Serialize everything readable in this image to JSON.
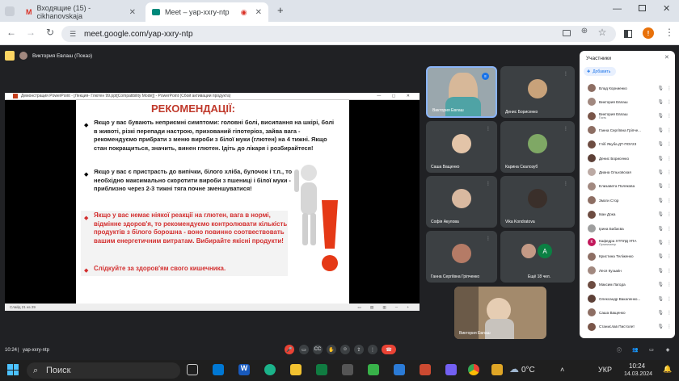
{
  "browser": {
    "tabs": [
      {
        "title": "Входящие (15) - cikhanovskaja",
        "icon": "gmail-icon"
      },
      {
        "title": "Meet – yap-xxry-ntp",
        "icon": "meet-icon"
      }
    ],
    "new_tab": "+",
    "url": "meet.google.com/yap-xxry-ntp",
    "profile_initial": "!"
  },
  "meet": {
    "presenter_label": "Виктория Евлаш (Показ)",
    "meeting_code": "yap-xxry-ntp",
    "time": "10:24",
    "presentation": {
      "window_title": "Демонстрация PowerPoint - [Лекция- Глютен 99.ppt[Compatibility Mode]] - PowerPoint (Сбой активации продукта)",
      "status": "Слайд 21 из 29",
      "slide_title": "РЕКОМЕНДАЦІЇ:",
      "paragraph_1": "Якщо у вас бувають неприємні симптоми: головні болі, висипання на шкірі, болі в животі, різкі перепади настрою, прихований гіпотеріоз, зайва вага - рекомендуємо прибрати з меню вироби з білої муки (глютен) на 4 тижні. Якщо стан покращиться, значить, винен глютен. Ідіть до лікаря і розбирайтеся!",
      "paragraph_2": "Якщо у вас є пристрасть до випічки, білого хліба, булочок і т.п., то необхідно максимально скоротити вироби з пшениці і білої муки - приблизно через 2-3 тижні тяга почне зменшуватися!",
      "paragraph_3": "Якщо у вас немає ніякої реакції на глютен, вага в нормі, відмінне здоров'я, то рекомендуємо контролювати кількість продуктів з білого борошна - воно повинно соотвествовать вашим енергетичним витратам. Вибирайте якісні продукти!",
      "paragraph_4": "Слідкуйте за здоров'ям свого кишечника."
    },
    "tiles": [
      {
        "name": "Виктория Евлаш"
      },
      {
        "name": "Денис Борисенко"
      },
      {
        "name": "Саша Ващенко"
      },
      {
        "name": "Карина Скалозуб"
      },
      {
        "name": "Софія Акулова"
      },
      {
        "name": "Vika Kondratova"
      },
      {
        "name": "Ганна Сергіївна Гріпченко"
      },
      {
        "name": "Ещё 18 чел.",
        "extra_initial": "A"
      }
    ],
    "self_tile_name": "Виктория Евлаш"
  },
  "participants": {
    "title": "Участники",
    "add_label": "Добавить",
    "list": [
      {
        "name": "Влад Корниенко",
        "color": "#8d6e63"
      },
      {
        "name": "Виктория Евлаш",
        "color": "#a1887f"
      },
      {
        "name": "Виктория Евлаш",
        "sub": "Гость",
        "color": "#795548"
      },
      {
        "name": "Ганна Сергіївна Гріпче...",
        "color": "#8d6e63"
      },
      {
        "name": "Гліб Якуба ДТ-ПОУ23",
        "color": "#6d4c41"
      },
      {
        "name": "Денис Борисенко",
        "color": "#5d4037"
      },
      {
        "name": "Диана Ольховская",
        "color": "#bcaaa4"
      },
      {
        "name": "Елизавета Полякова",
        "color": "#a1887f"
      },
      {
        "name": "Змоги Стор",
        "color": "#8d6e63"
      },
      {
        "name": "Іван Дока",
        "color": "#6d4c41"
      },
      {
        "name": "Ірина Бабаєва",
        "color": "#9e9e9e"
      },
      {
        "name": "Кафедра ХТПЛД УПА",
        "sub": "Организатор",
        "color": "#c2185b",
        "initial": "К"
      },
      {
        "name": "Кристина Теліженко",
        "color": "#8d6e63"
      },
      {
        "name": "Леся Кузьмін",
        "color": "#a1887f"
      },
      {
        "name": "Максим Лагода",
        "color": "#6d4c41"
      },
      {
        "name": "Олександр Вакаленко...",
        "color": "#5d4037"
      },
      {
        "name": "Саша Ващенко",
        "color": "#8d6e63"
      },
      {
        "name": "Станислав Пистолет",
        "color": "#795548"
      }
    ]
  },
  "taskbar": {
    "search_placeholder": "Поиск",
    "weather": "0°C",
    "language": "УКР",
    "time": "10:24",
    "date": "14.03.2024"
  }
}
